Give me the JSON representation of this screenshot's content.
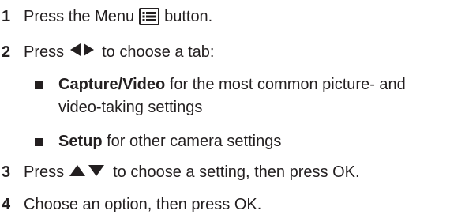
{
  "steps": [
    {
      "num": "1",
      "before": "Press the Menu",
      "icon": "menu-list-icon",
      "after": "button."
    },
    {
      "num": "2",
      "before": "Press",
      "icon": "left-right-arrows-icon",
      "after": "to choose a tab:"
    },
    {
      "num": "3",
      "before": "Press",
      "icon": "up-down-arrows-icon",
      "after": "to choose a setting, then press OK."
    },
    {
      "num": "4",
      "text": "Choose an option, then press OK."
    }
  ],
  "bullets": [
    {
      "bold": "Capture/Video",
      "line1": " for the most common picture- and",
      "line2": "video-taking settings"
    },
    {
      "bold": "Setup",
      "line1": " for other camera settings"
    }
  ],
  "colors": {
    "text": "#231f20"
  }
}
